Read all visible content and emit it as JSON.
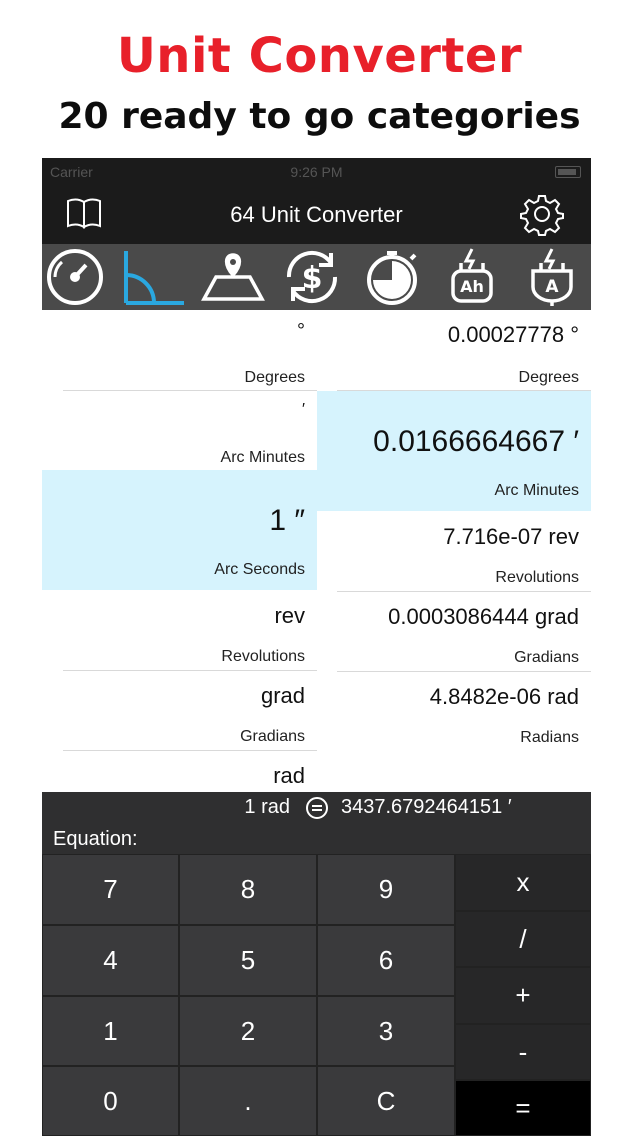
{
  "promo": {
    "title": "Unit Converter",
    "subtitle": "20 ready to go categories"
  },
  "status_bar": {
    "carrier": "Carrier",
    "time": "9:26 PM"
  },
  "nav": {
    "title": "64 Unit Converter",
    "left_icon": "book-icon",
    "right_icon": "gear-icon"
  },
  "categories": [
    {
      "icon": "speedometer-icon",
      "selected": false
    },
    {
      "icon": "angle-icon",
      "selected": true
    },
    {
      "icon": "map-area-icon",
      "selected": false
    },
    {
      "icon": "currency-exchange-icon",
      "selected": false
    },
    {
      "icon": "stopwatch-icon",
      "selected": false
    },
    {
      "icon": "battery-ah-icon",
      "selected": false
    },
    {
      "icon": "current-ampere-icon",
      "selected": false
    }
  ],
  "left_units": [
    {
      "value": "°",
      "label": "Degrees"
    },
    {
      "value": "′",
      "label": "Arc Minutes"
    },
    {
      "value": "1 ″",
      "label": "Arc Seconds"
    },
    {
      "value": "rev",
      "label": "Revolutions"
    },
    {
      "value": "grad",
      "label": "Gradians"
    },
    {
      "value": "rad",
      "label": ""
    }
  ],
  "right_units": [
    {
      "value": "0.00027778 °",
      "label": "Degrees"
    },
    {
      "value": "0.0166664667 ′",
      "label": "Arc Minutes"
    },
    {
      "value": "7.716e-07 rev",
      "label": "Revolutions"
    },
    {
      "value": "0.0003086444 grad",
      "label": "Gradians"
    },
    {
      "value": "4.8482e-06 rad",
      "label": "Radians"
    }
  ],
  "equation": {
    "lhs": "1 rad",
    "rhs": "3437.6792464151 ′",
    "label": "Equation:"
  },
  "keypad": {
    "digits": [
      "7",
      "8",
      "9",
      "4",
      "5",
      "6",
      "1",
      "2",
      "3",
      "0",
      ".",
      "C"
    ],
    "ops": [
      "x",
      "/",
      "+",
      "-",
      "="
    ]
  },
  "colors": {
    "promo_red": "#e8202a",
    "highlight": "#d6f3fd",
    "selected_category": "#2aa8e0"
  }
}
